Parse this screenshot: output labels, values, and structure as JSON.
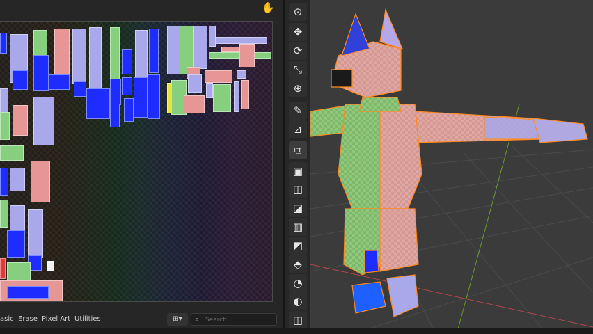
{
  "uv_editor": {
    "footer_tabs": [
      "asic",
      "Erase",
      "Pixel Art",
      "Utilities"
    ],
    "search_placeholder": "Search",
    "view_mode_label": "▾"
  },
  "toolbar": {
    "tools": [
      "cursor-icon",
      "move-icon",
      "rotate-icon",
      "scale-icon",
      "transform-icon",
      "annotate-icon",
      "measure-icon",
      "add-cube-icon",
      "extrude-icon",
      "inset-icon",
      "bevel-icon",
      "loop-cut-icon",
      "knife-icon",
      "poly-build-icon",
      "spin-icon",
      "smooth-icon",
      "shear-icon"
    ]
  },
  "colors": {
    "uv_blue": "#1e2cff",
    "uv_green": "#86cf7f",
    "uv_pink": "#e79696",
    "uv_lavender": "#a8a8ea",
    "selection_orange": "#ff8a1e"
  }
}
